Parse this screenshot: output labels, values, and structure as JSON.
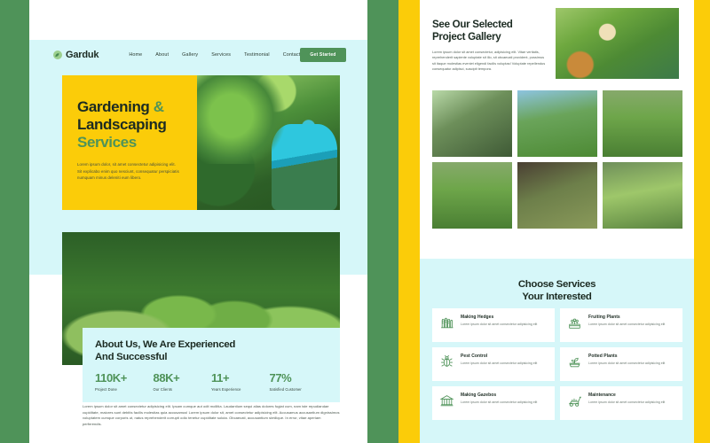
{
  "brand": {
    "name": "Garduk",
    "logo_icon": "leaf-circle-icon",
    "accent_green": "#4f9359",
    "accent_yellow": "#fbcc09",
    "accent_cyan": "#d6f7f9",
    "dark": "#1c2b22"
  },
  "nav": {
    "items": [
      {
        "label": "Home"
      },
      {
        "label": "About"
      },
      {
        "label": "Gallery"
      },
      {
        "label": "Services"
      },
      {
        "label": "Testimonial"
      },
      {
        "label": "Contact"
      }
    ],
    "cta_label": "Get Started"
  },
  "hero": {
    "line1": "Gardening",
    "amp": "&",
    "line2": "Landscaping",
    "line3": "Services",
    "paragraph": "Lorem ipsum dolor, sit amet consectetur adipisicing elit. Sit explicabo enim quo nesciunt, consequatur perspiciatis numquam minus deleniti eum libero.",
    "image_alt": "gardener-trimming-topiary-photo"
  },
  "about": {
    "image_alt": "potted-herbs-garden-photo",
    "heading_line1": "About Us, We Are Experienced",
    "heading_line2": "And Successful",
    "stats": [
      {
        "value": "110K+",
        "label": "Project Done"
      },
      {
        "value": "88K+",
        "label": "Our Clients"
      },
      {
        "value": "11+",
        "label": "Years Experience"
      },
      {
        "value": "77%",
        "label": "Satisfied Customer"
      }
    ],
    "body": "Lorem ipsum dolor sit amet consectetur adipisicing elit. Ipsam cumque aut odit mollitia. Laudantium sequi alias dolores fugiat cum, nam iste repudiandae cupiditate, maiores sunt debitis facilis molestias quia accusamus! Lorem ipsum dolor sit, amet consectetur adipisicing elit. Accusamus accusantium dignissimos voluptatem cumque corporis ut, natus reprehenderit corrupti odio tenetur cupiditate soluta. Obcaecati, accusantium similique. In error, vitae aperiam perferendis."
  },
  "gallery": {
    "heading_line1": "See Our Selected",
    "heading_line2": "Project Gallery",
    "paragraph": "Lorem ipsum dolor sit amet consectetur, adipisicing elit. Vitae veritatis, reprehenderit sapiente voluptate sit illo, sit obcaecati provident, possimus sit itaque molestias eveniet eligendi facilis voluptas! Voluptate repellendus consequatur adipisci, suscipit tempora.",
    "feature_image_alt": "senior-gardener-with-hat-photo",
    "images": [
      {
        "alt": "man-watering-plants-greenhouse-photo"
      },
      {
        "alt": "lawn-sprinkler-watering-photo"
      },
      {
        "alt": "raised-vegetable-bed-photo"
      },
      {
        "alt": "raised-vegetable-bed-photo-2"
      },
      {
        "alt": "potted-herbs-on-patio-photo"
      },
      {
        "alt": "garden-archway-trellis-photo"
      }
    ]
  },
  "services": {
    "heading_line1": "Choose Services",
    "heading_line2": "Your Interested",
    "items": [
      {
        "icon": "hedge-icon",
        "title": "Making Hedges",
        "desc": "Lorem ipsum dolor sit amet consectetur adipisicing elit"
      },
      {
        "icon": "fruiting-plants-icon",
        "title": "Fruiting Plants",
        "desc": "Lorem ipsum dolor sit amet consectetur adipisicing elit"
      },
      {
        "icon": "bug-icon",
        "title": "Pest Control",
        "desc": "Lorem ipsum dolor sit amet consectetur adipisicing elit"
      },
      {
        "icon": "potted-plant-icon",
        "title": "Potted Plants",
        "desc": "Lorem ipsum dolor sit amet consectetur adipisicing elit"
      },
      {
        "icon": "gazebo-icon",
        "title": "Making Gazebos",
        "desc": "Lorem ipsum dolor sit amet consectetur adipisicing elit"
      },
      {
        "icon": "lawn-mower-icon",
        "title": "Maintenance",
        "desc": "Lorem ipsum dolor sit amet consectetur adipisicing elit"
      }
    ]
  }
}
